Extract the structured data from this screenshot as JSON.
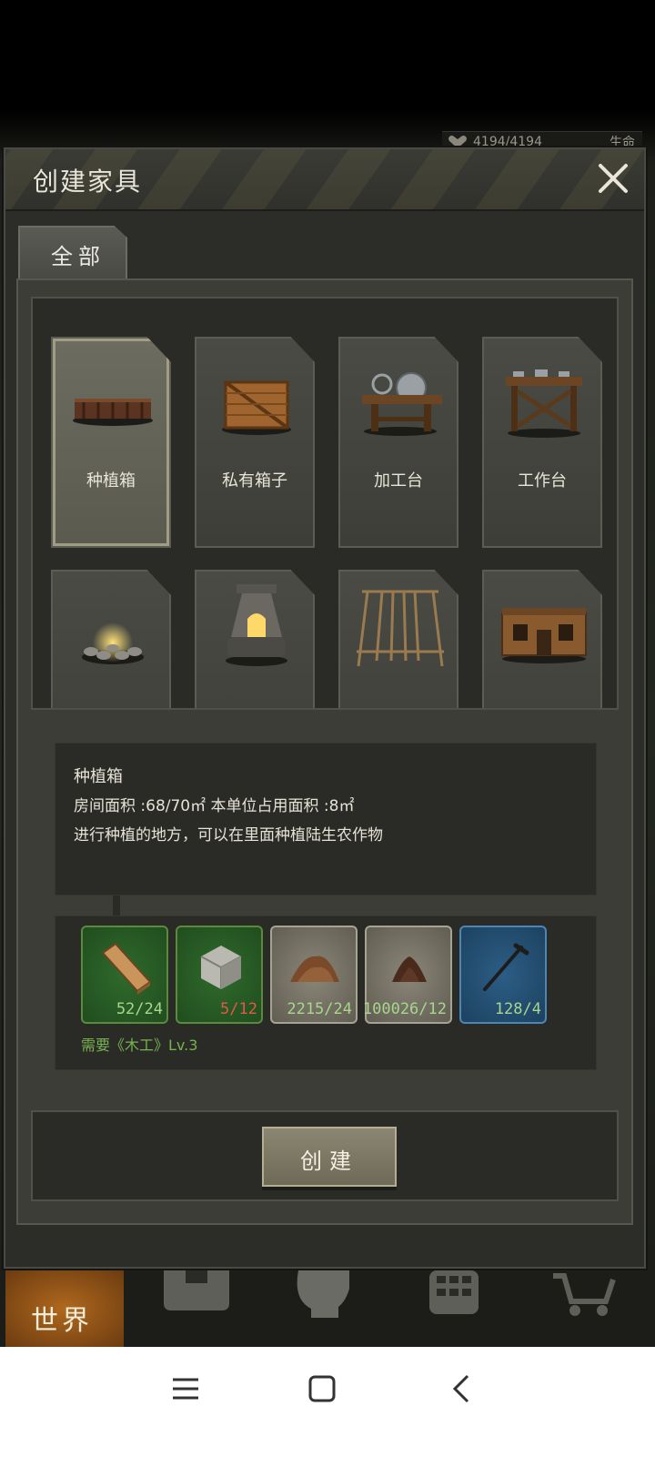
{
  "status": {
    "hp": "4194/4194",
    "hp_label": "生命"
  },
  "dialog": {
    "title": "创建家具"
  },
  "tabs": [
    {
      "label": "全部"
    }
  ],
  "items": [
    {
      "name": "种植箱",
      "icon": "planter-box-icon"
    },
    {
      "name": "私有箱子",
      "icon": "wooden-crate-icon"
    },
    {
      "name": "加工台",
      "icon": "saw-table-icon"
    },
    {
      "name": "工作台",
      "icon": "workbench-icon"
    },
    {
      "name": "",
      "icon": "campfire-icon"
    },
    {
      "name": "",
      "icon": "furnace-icon"
    },
    {
      "name": "",
      "icon": "drying-rack-icon"
    },
    {
      "name": "",
      "icon": "wooden-house-icon"
    }
  ],
  "details": {
    "name": "种植箱",
    "area": "房间面积 :68/70㎡ 本单位占用面积 :8㎡",
    "description": "进行种植的地方，可以在里面种植陆生农作物"
  },
  "materials": [
    {
      "count": "52/24",
      "icon": "wood-plank-icon",
      "color": "green",
      "sufficient": true
    },
    {
      "count": "5/12",
      "icon": "stone-block-icon",
      "color": "green",
      "sufficient": false
    },
    {
      "count": "2215/24",
      "icon": "dirt-pile-icon",
      "color": "gray",
      "sufficient": true
    },
    {
      "count": "100026/12",
      "icon": "fertilizer-pile-icon",
      "color": "gray",
      "sufficient": true
    },
    {
      "count": "128/4",
      "icon": "nail-icon",
      "color": "blue",
      "sufficient": true
    }
  ],
  "requirement": "需要《木工》Lv.3",
  "create_button": "创建",
  "game_nav": {
    "world": "世界"
  },
  "colors": {
    "accent": "#b0681d",
    "ok": "#a7d68d",
    "bad": "#e0594a",
    "req": "#76b34f"
  }
}
